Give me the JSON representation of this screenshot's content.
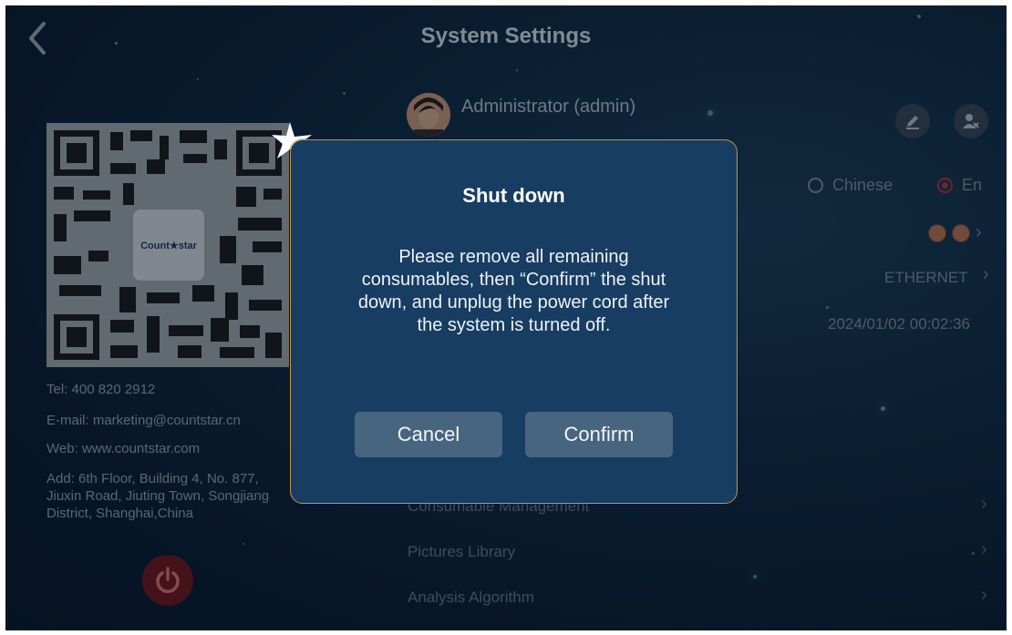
{
  "header": {
    "title": "System Settings",
    "back_icon": "chevron-left-icon"
  },
  "company": {
    "qr_logo_text": "Count★star",
    "tel": "Tel: 400 820 2912",
    "email": "E-mail: marketing@countstar.cn",
    "web": "Web: www.countstar.com",
    "address": "Add: 6th Floor, Building 4, No. 877, Jiuxin Road, Jiuting Town, Songjiang District, Shanghai,China"
  },
  "user": {
    "name": "Administrator (admin)",
    "edit_icon": "edit-icon",
    "switch_user_icon": "user-remove-icon"
  },
  "language": {
    "option_chinese": "Chinese",
    "option_english": "En",
    "selected": "En"
  },
  "network": {
    "value": "ETHERNET"
  },
  "datetime": {
    "value": "2024/01/02 00:02:36"
  },
  "menu": {
    "items": [
      {
        "label": "Consumable Management"
      },
      {
        "label": "Pictures Library"
      },
      {
        "label": "Analysis Algorithm"
      }
    ]
  },
  "dialog": {
    "title": "Shut down",
    "message": "Please remove all remaining consumables, then “Confirm” the shut down, and unplug the power cord after the system is turned off.",
    "cancel_label": "Cancel",
    "confirm_label": "Confirm"
  },
  "colors": {
    "modal_border": "#c8943e",
    "power_button": "#7a1418",
    "radio_selected": "#c43a3a"
  }
}
